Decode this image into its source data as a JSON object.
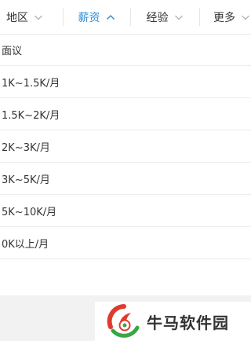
{
  "filter_bar": {
    "tabs": [
      {
        "label": "地区",
        "icon": "chevron-down-icon",
        "active": false
      },
      {
        "label": "薪资",
        "icon": "chevron-up-icon",
        "active": true
      },
      {
        "label": "经验",
        "icon": "chevron-down-icon",
        "active": false
      },
      {
        "label": "更多",
        "icon": "chevron-down-icon",
        "active": false
      }
    ]
  },
  "salary_options": [
    "面议",
    "1K~1.5K/月",
    "1.5K~2K/月",
    "2K~3K/月",
    "3K~5K/月",
    "5K~10K/月",
    "0K以上/月"
  ],
  "watermark": {
    "text": "牛马软件园",
    "icon": "brand-logo-icon"
  },
  "colors": {
    "accent": "#2c8cd6",
    "text": "#333333",
    "divider": "#ececec",
    "logo_red": "#e03a2f",
    "logo_green": "#3aa547"
  }
}
